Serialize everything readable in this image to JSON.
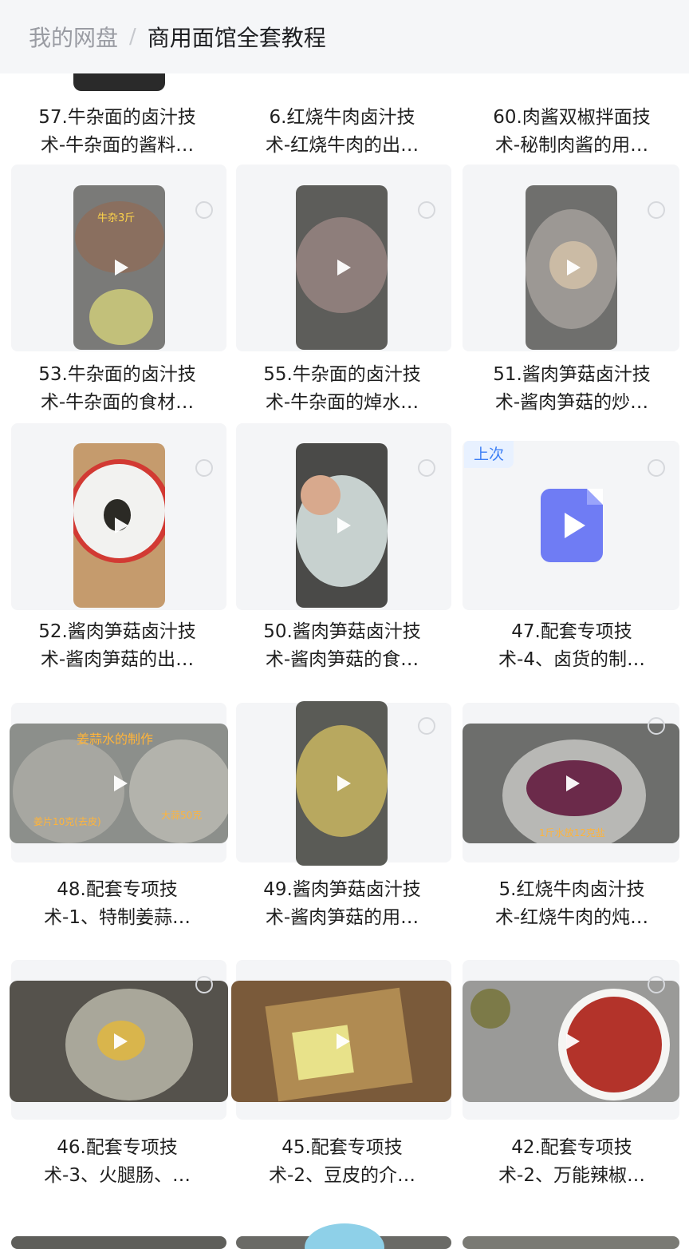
{
  "breadcrumb": {
    "root": "我的网盘",
    "separator": "/",
    "current": "商用面馆全套教程"
  },
  "items": [
    {
      "title1": "57.牛杂面的卤汁技",
      "title2": "术-牛杂面的酱料…"
    },
    {
      "title1": "6.红烧牛肉卤汁技",
      "title2": "术-红烧牛肉的出…"
    },
    {
      "title1": "60.肉酱双椒拌面技",
      "title2": "术-秘制肉酱的用…"
    },
    {
      "title1": "53.牛杂面的卤汁技",
      "title2": "术-牛杂面的食材…"
    },
    {
      "title1": "55.牛杂面的卤汁技",
      "title2": "术-牛杂面的焯水…"
    },
    {
      "title1": "51.酱肉笋菇卤汁技",
      "title2": "术-酱肉笋菇的炒…"
    },
    {
      "title1": "52.酱肉笋菇卤汁技",
      "title2": "术-酱肉笋菇的出…"
    },
    {
      "title1": "50.酱肉笋菇卤汁技",
      "title2": "术-酱肉笋菇的食…"
    },
    {
      "title1": "47.配套专项技",
      "title2": "术-4、卤货的制…",
      "badge": "上次"
    },
    {
      "title1": "48.配套专项技",
      "title2": "术-1、特制姜蒜…"
    },
    {
      "title1": "49.酱肉笋菇卤汁技",
      "title2": "术-酱肉笋菇的用…"
    },
    {
      "title1": "5.红烧牛肉卤汁技",
      "title2": "术-红烧牛肉的炖…"
    },
    {
      "title1": "46.配套专项技",
      "title2": "术-3、火腿肠、…"
    },
    {
      "title1": "45.配套专项技",
      "title2": "术-2、豆皮的介…"
    },
    {
      "title1": "42.配套专项技",
      "title2": "术-2、万能辣椒…"
    }
  ],
  "thumbnail_overlay_text": {
    "item3": "牛杂3斤",
    "item9_top": "姜蒜水的制作",
    "item9_left": "姜片10克(去皮)",
    "item9_right": "大蒜50克",
    "item11": "1斤水放12克盐"
  },
  "icons": {
    "play": "play-icon",
    "select": "select-circle-icon",
    "video_file": "video-file-icon"
  },
  "colors": {
    "accent": "#3d7ff5",
    "video_icon": "#6f7cf4"
  }
}
